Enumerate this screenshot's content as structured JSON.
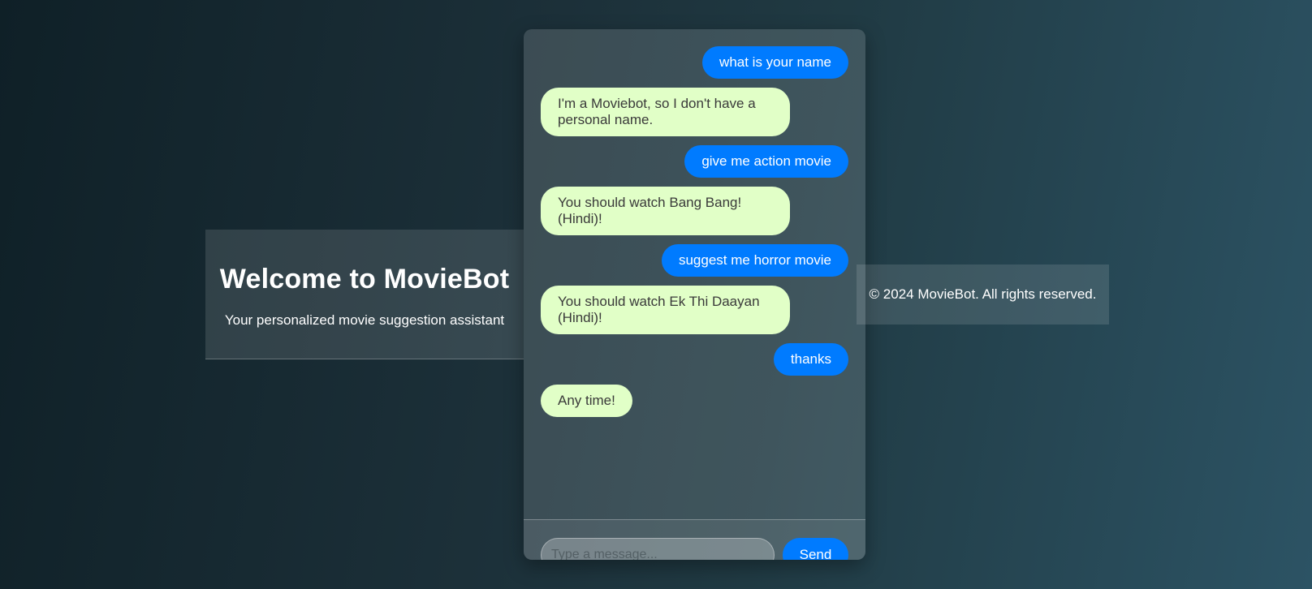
{
  "header": {
    "title": "Welcome to MovieBot",
    "subtitle": "Your personalized movie suggestion assistant"
  },
  "footer": {
    "text": "© 2024 MovieBot. All rights reserved."
  },
  "chat": {
    "messages": [
      {
        "sender": "user",
        "text": "what is your name"
      },
      {
        "sender": "bot",
        "text": "I'm a Moviebot, so I don't have a personal name."
      },
      {
        "sender": "user",
        "text": "give me action movie"
      },
      {
        "sender": "bot",
        "text": "You should watch Bang Bang! (Hindi)!"
      },
      {
        "sender": "user",
        "text": "suggest me horror movie"
      },
      {
        "sender": "bot",
        "text": "You should watch Ek Thi Daayan (Hindi)!"
      },
      {
        "sender": "user",
        "text": "thanks"
      },
      {
        "sender": "bot",
        "text": "Any time!"
      }
    ],
    "input": {
      "placeholder": "Type a message...",
      "value": ""
    },
    "send_label": "Send"
  },
  "colors": {
    "user_bubble": "#007bff",
    "bot_bubble": "#e1ffc7",
    "send_button": "#007bff"
  }
}
